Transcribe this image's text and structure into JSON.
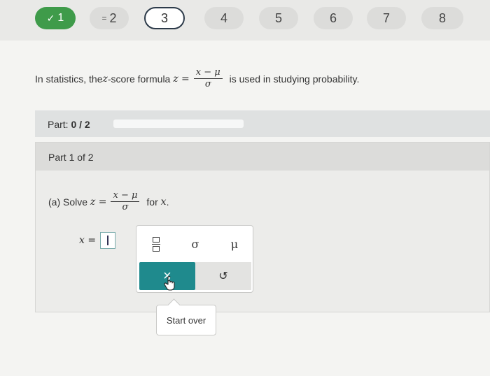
{
  "nav": {
    "questions": [
      {
        "label": "1",
        "state": "done",
        "mark": "✓"
      },
      {
        "label": "2",
        "state": "partial",
        "mark": "="
      },
      {
        "label": "3",
        "state": "current",
        "mark": ""
      },
      {
        "label": "4",
        "state": "todo",
        "mark": ""
      },
      {
        "label": "5",
        "state": "todo",
        "mark": ""
      },
      {
        "label": "6",
        "state": "todo",
        "mark": ""
      },
      {
        "label": "7",
        "state": "todo",
        "mark": ""
      },
      {
        "label": "8",
        "state": "todo",
        "mark": ""
      }
    ]
  },
  "problem": {
    "prefix": "In statistics, the ",
    "z": "z",
    "mid": "-score formula ",
    "eq": "z =",
    "frac_num": "x − μ",
    "frac_den": "σ",
    "suffix": " is used in studying probability."
  },
  "part_bar": {
    "label": "Part: ",
    "value": "0 / 2",
    "progress": 0
  },
  "panel": {
    "header": "Part 1 of 2"
  },
  "question": {
    "prefix": "(a) Solve ",
    "eq": "z =",
    "frac_num": "x − μ",
    "frac_den": "σ",
    "for": "for ",
    "var": "x",
    "end": "."
  },
  "answer": {
    "label": "x ="
  },
  "keypad": {
    "sigma": "σ",
    "mu": "μ",
    "clear": "×",
    "undo": "↺",
    "icons": [
      "fraction-icon",
      "close-icon",
      "undo-icon",
      "hand-pointer-icon"
    ]
  },
  "tooltip": {
    "text": "Start over"
  },
  "colors": {
    "done": "#3f9b4a",
    "teal": "#1f8a8d",
    "current_border": "#2d3b4a"
  }
}
